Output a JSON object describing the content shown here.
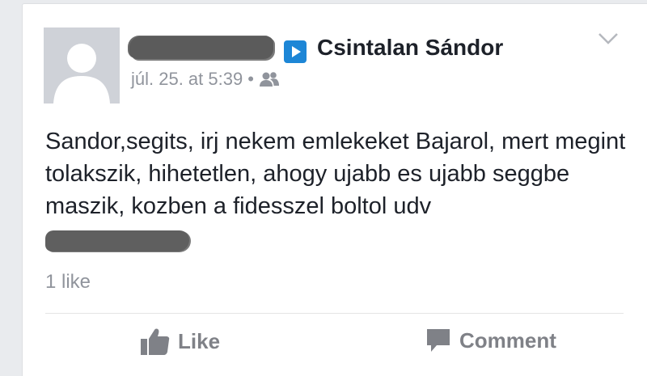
{
  "post": {
    "author_redacted": true,
    "target_name": "Csintalan Sándor",
    "timestamp": "júl. 25. at 5:39",
    "separator": "•",
    "audience_icon": "friends-icon",
    "body": "Sandor,segits, irj nekem emlekeket Bajarol, mert megint tolakszik, hihetetlen, ahogy ujabb es ujabb seggbe maszik, kozben a fidesszel boltol udv",
    "signature_redacted": true,
    "likes": "1 like"
  },
  "actions": {
    "like_label": "Like",
    "comment_label": "Comment"
  },
  "colors": {
    "name": "#1d2129",
    "meta": "#90949c",
    "accent": "#1d86d6",
    "action": "#7f8187"
  }
}
